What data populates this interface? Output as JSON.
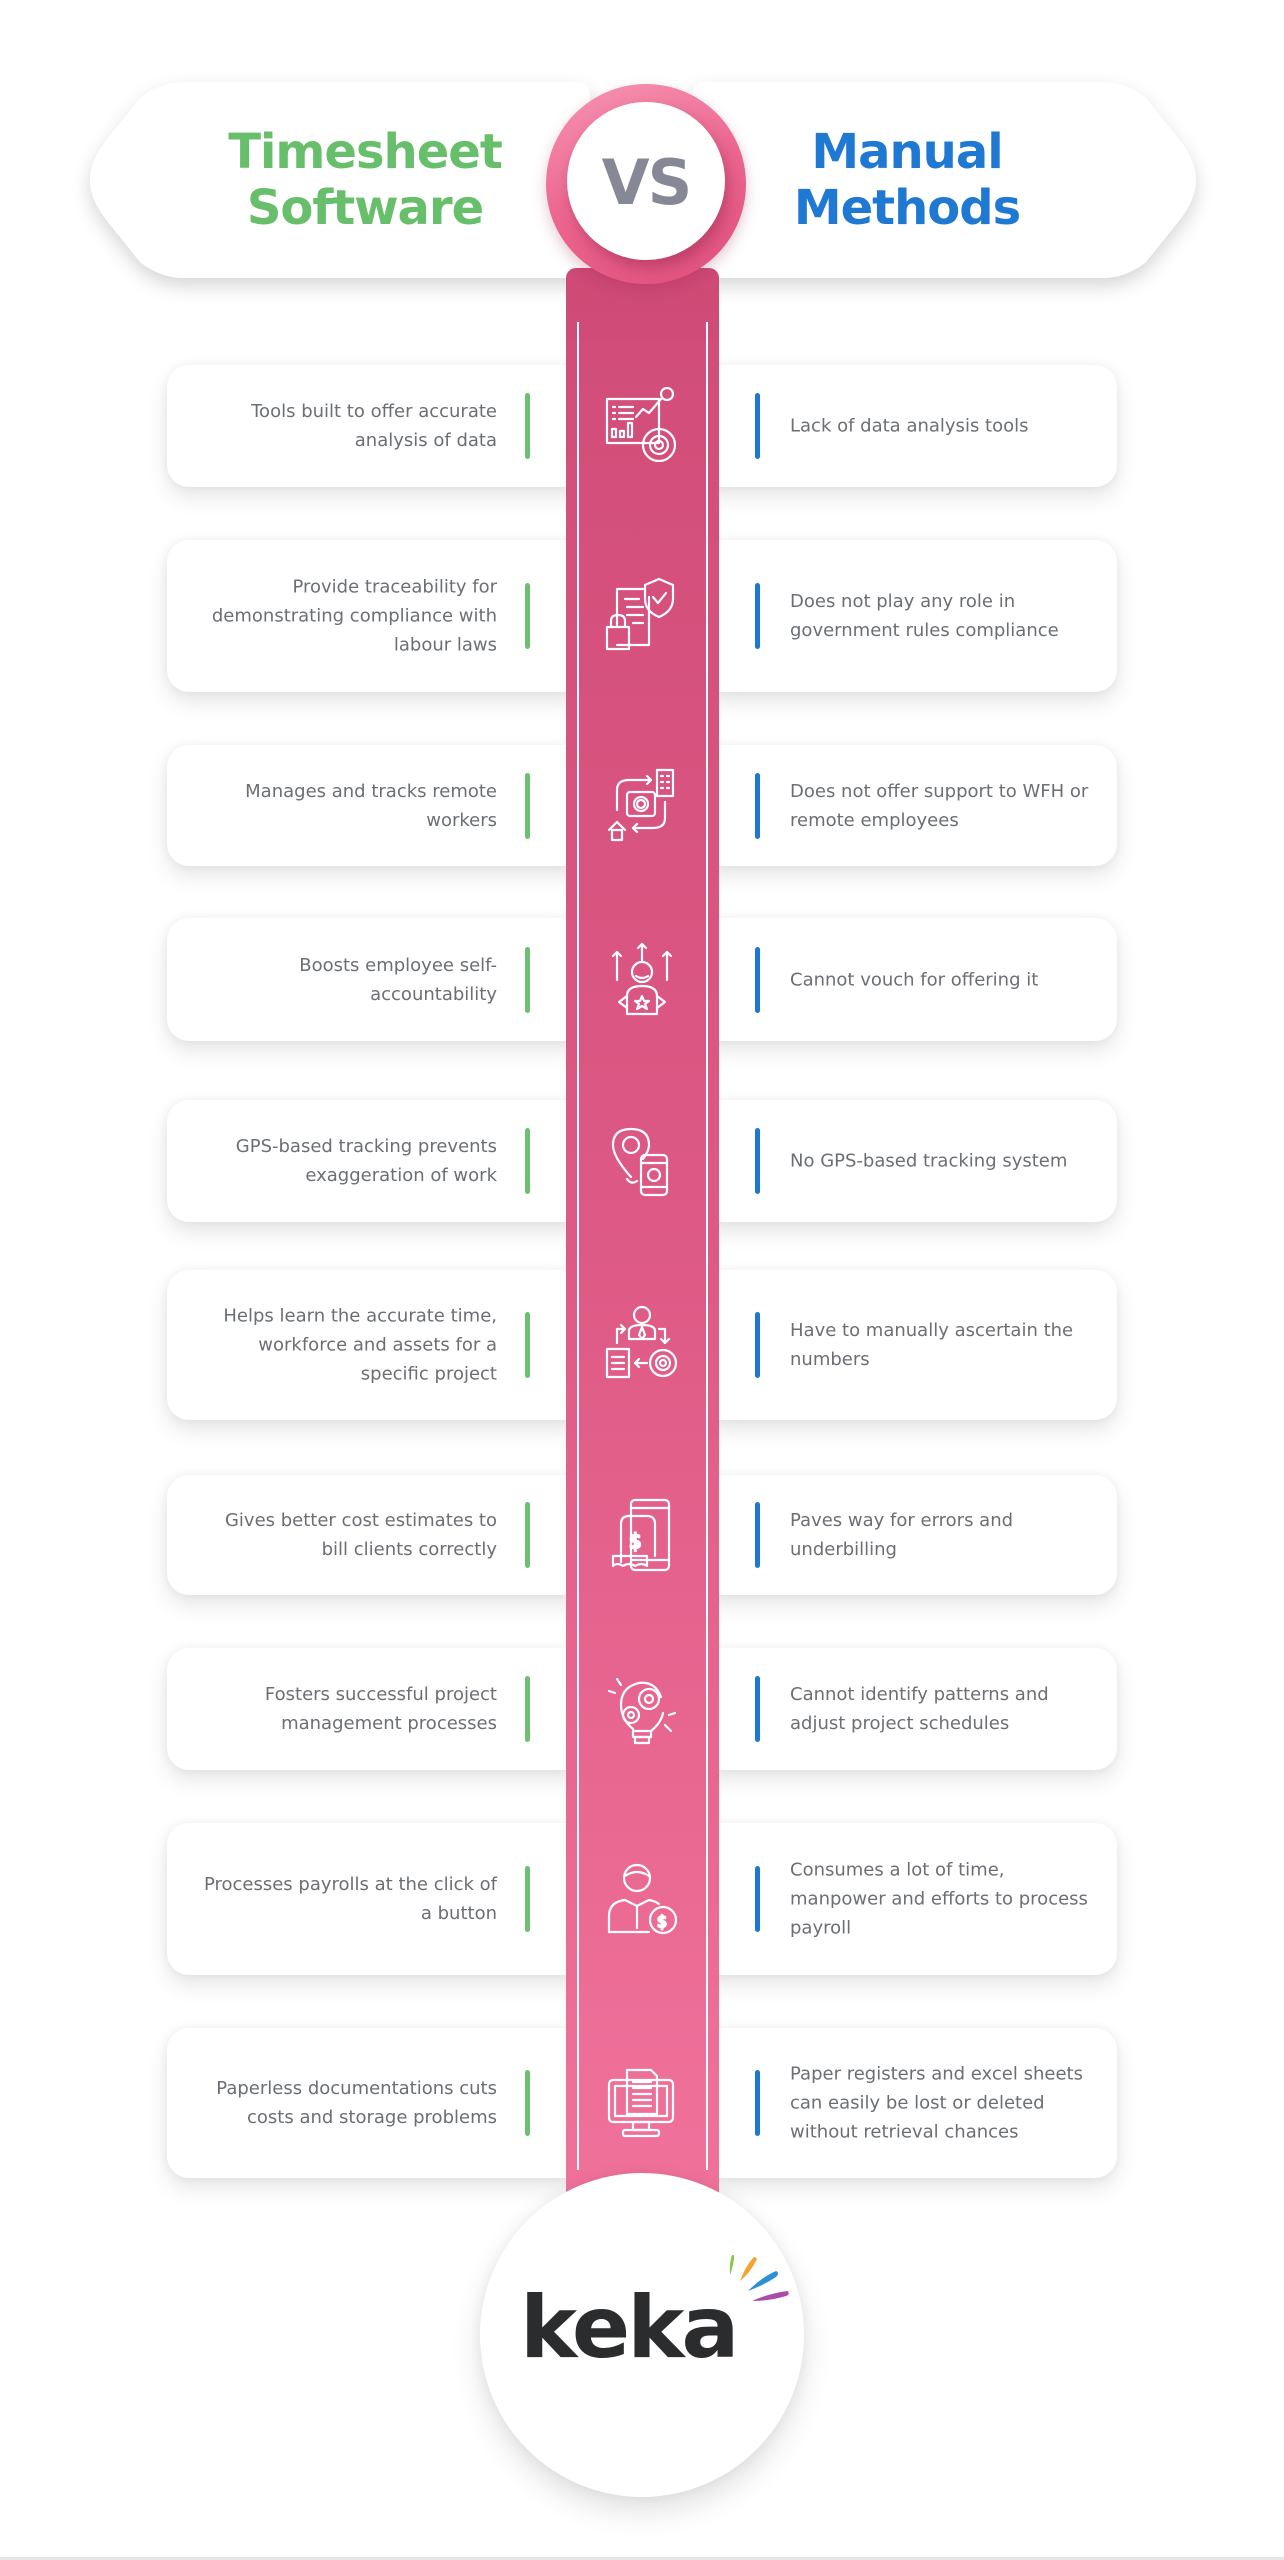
{
  "header": {
    "left_title": [
      "Timesheet",
      "Software"
    ],
    "right_title": [
      "Manual",
      "Methods"
    ],
    "vs_label": "VS"
  },
  "colors": {
    "software_accent": "#67be6b",
    "manual_accent": "#1f78d1",
    "column_top": "#cf4a76",
    "column_bottom": "#f0729b",
    "text": "#6b6f74",
    "vs_text": "#868995"
  },
  "rows": [
    {
      "icon": "data-analytics-icon",
      "software": "Tools built to offer accurate analysis of data",
      "manual": "Lack of data analysis tools"
    },
    {
      "icon": "compliance-document-shield-icon",
      "software": "Provide traceability for demonstrating compliance with labour laws",
      "manual": "Does not play any role in government rules compliance"
    },
    {
      "icon": "remote-work-icon",
      "software": "Manages and tracks remote workers",
      "manual": "Does not offer support to WFH or remote employees"
    },
    {
      "icon": "employee-growth-icon",
      "software": "Boosts employee self-accountability",
      "manual": "Cannot vouch for offering it"
    },
    {
      "icon": "gps-location-phone-icon",
      "software": "GPS-based tracking prevents exaggeration of work",
      "manual": "No GPS-based tracking system"
    },
    {
      "icon": "workforce-process-icon",
      "software": "Helps learn the accurate time, workforce and assets for a specific project",
      "manual": "Have to manually ascertain the numbers"
    },
    {
      "icon": "billing-invoice-icon",
      "software": "Gives better cost estimates to bill clients correctly",
      "manual": "Paves way for errors and underbilling"
    },
    {
      "icon": "idea-gear-bulb-icon",
      "software": "Fosters successful project management processes",
      "manual": "Cannot identify patterns and adjust project schedules"
    },
    {
      "icon": "payroll-person-dollar-icon",
      "software": "Processes payrolls at the click of a button",
      "manual": "Consumes a lot of time, manpower and efforts to process payroll"
    },
    {
      "icon": "paperless-monitor-document-icon",
      "software": "Paperless documentations cuts costs and storage problems",
      "manual": "Paper registers and excel sheets can easily be lost or deleted without retrieval chances"
    }
  ],
  "logo": {
    "wordmark": "keka",
    "ray_colors": [
      "#8bc552",
      "#f2a531",
      "#2d8fd5",
      "#a94ea6"
    ]
  }
}
